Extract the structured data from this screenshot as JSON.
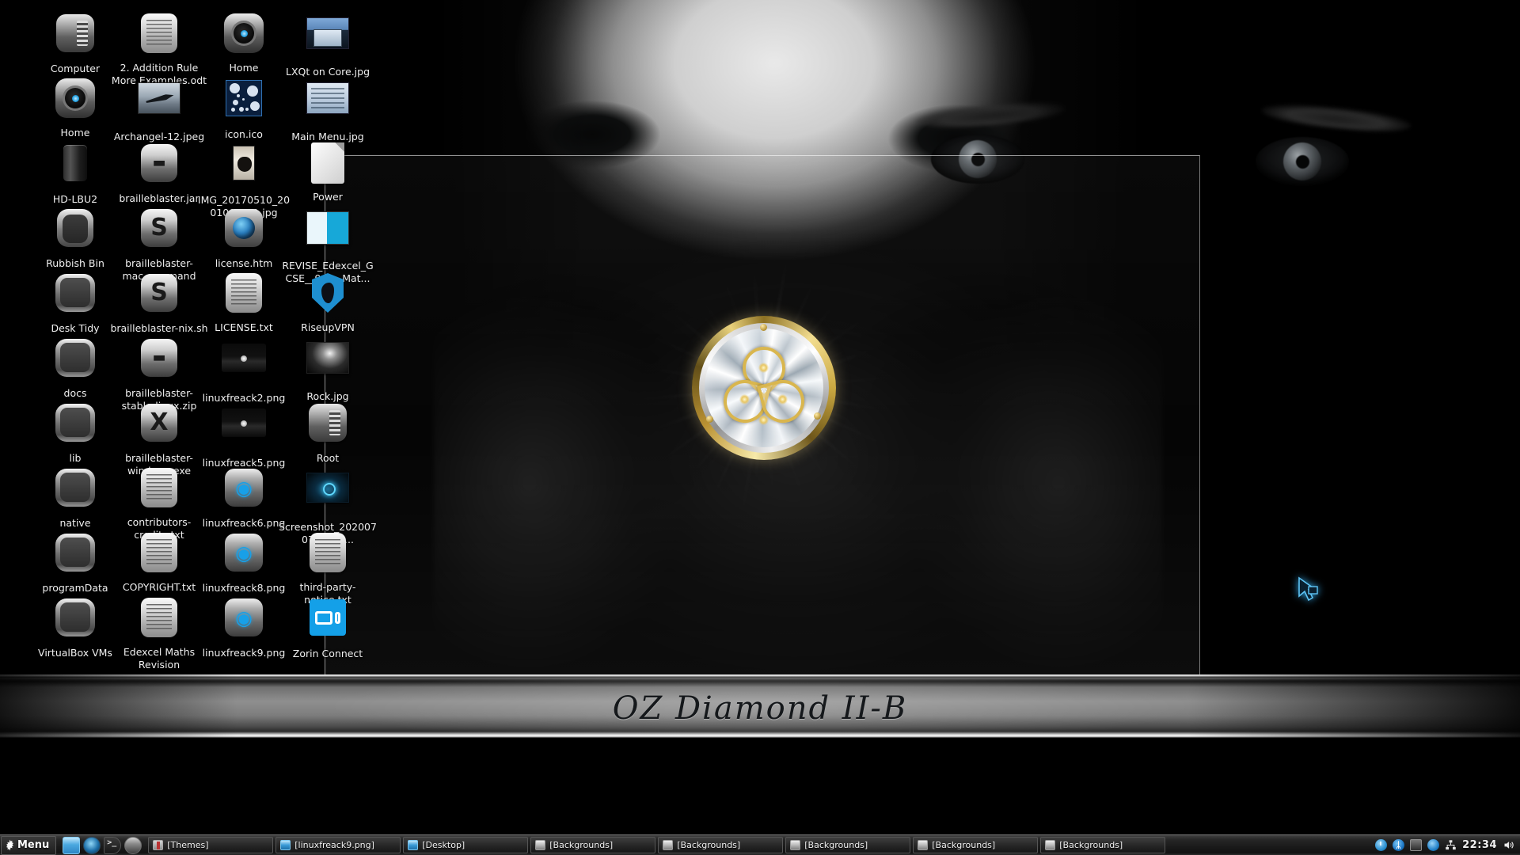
{
  "desktop": {
    "wallpaper_title": "OZ Diamond II-B",
    "emblem_name": "triquetra-diamond-emblem",
    "cursor_name": "blue-glow-pointer"
  },
  "icons": [
    {
      "label": "Computer",
      "art": "comp",
      "col": 0,
      "row": 0
    },
    {
      "label": "2. Addition Rule More Examples.odt",
      "art": "doc",
      "col": 1,
      "row": 0
    },
    {
      "label": "Home",
      "art": "home",
      "col": 2,
      "row": 0
    },
    {
      "label": "LXQt on Core.jpg",
      "art": "lxqt",
      "col": 3,
      "row": 0
    },
    {
      "label": "Home",
      "art": "home",
      "col": 0,
      "row": 1
    },
    {
      "label": "Archangel-12.jpeg",
      "art": "jet",
      "col": 1,
      "row": 1
    },
    {
      "label": "icon.ico",
      "art": "ico",
      "col": 2,
      "row": 1
    },
    {
      "label": "Main Menu.jpg",
      "art": "menu",
      "col": 3,
      "row": 1
    },
    {
      "label": "HD-LBU2",
      "art": "hd",
      "col": 0,
      "row": 2
    },
    {
      "label": "brailleblaster.jar",
      "art": "bbjar",
      "col": 1,
      "row": 2
    },
    {
      "label": "IMG_20170510_200100_001.jpg",
      "art": "cat",
      "col": 2,
      "row": 2
    },
    {
      "label": "Power",
      "art": "plain",
      "col": 3,
      "row": 2
    },
    {
      "label": "Rubbish Bin",
      "art": "bin",
      "col": 0,
      "row": 3
    },
    {
      "label": "brailleblaster-mac.command",
      "art": "bbS",
      "col": 1,
      "row": 3
    },
    {
      "label": "license.htm",
      "art": "globe",
      "col": 2,
      "row": 3
    },
    {
      "label": "REVISE_Edexcel_GCSE__9_1__Mat...",
      "art": "book",
      "col": 3,
      "row": 3
    },
    {
      "label": "Desk Tidy",
      "art": "folder",
      "col": 0,
      "row": 4
    },
    {
      "label": "brailleblaster-nix.sh",
      "art": "bbS",
      "col": 1,
      "row": 4
    },
    {
      "label": "LICENSE.txt",
      "art": "doc",
      "col": 2,
      "row": 4
    },
    {
      "label": "RiseupVPN",
      "art": "shield",
      "col": 3,
      "row": 4
    },
    {
      "label": "docs",
      "art": "folder",
      "col": 0,
      "row": 5
    },
    {
      "label": "brailleblaster-stable-linux.zip",
      "art": "bbjar",
      "col": 1,
      "row": 5
    },
    {
      "label": "linuxfreack2.png",
      "art": "lf",
      "col": 2,
      "row": 5
    },
    {
      "label": "Rock.jpg",
      "art": "rock",
      "col": 3,
      "row": 5
    },
    {
      "label": "lib",
      "art": "folder",
      "col": 0,
      "row": 6
    },
    {
      "label": "brailleblaster-windows.exe",
      "art": "bbX",
      "col": 1,
      "row": 6
    },
    {
      "label": "linuxfreack5.png",
      "art": "lf",
      "col": 2,
      "row": 6
    },
    {
      "label": "Root",
      "art": "comp",
      "col": 3,
      "row": 6
    },
    {
      "label": "native",
      "art": "folder",
      "col": 0,
      "row": 7
    },
    {
      "label": "contributors-credits.txt",
      "art": "doc",
      "col": 1,
      "row": 7
    },
    {
      "label": "linuxfreack6.png",
      "art": "lfb",
      "col": 2,
      "row": 7
    },
    {
      "label": "Screenshot_20200707_2309...",
      "art": "shot",
      "col": 3,
      "row": 7
    },
    {
      "label": "programData",
      "art": "folder",
      "col": 0,
      "row": 8
    },
    {
      "label": "COPYRIGHT.txt",
      "art": "doc",
      "col": 1,
      "row": 8
    },
    {
      "label": "linuxfreack8.png",
      "art": "lfb",
      "col": 2,
      "row": 8
    },
    {
      "label": "third-party-notice.txt",
      "art": "doc",
      "col": 3,
      "row": 8
    },
    {
      "label": "VirtualBox VMs",
      "art": "folder",
      "col": 0,
      "row": 9
    },
    {
      "label": "Edexcel Maths Revision",
      "art": "doc",
      "col": 1,
      "row": 9
    },
    {
      "label": "linuxfreack9.png",
      "art": "lfb",
      "col": 2,
      "row": 9
    },
    {
      "label": "Zorin Connect",
      "art": "zorin",
      "col": 3,
      "row": 9
    }
  ],
  "taskbar": {
    "menu_label": "Menu",
    "menu_icon": "gear-icon",
    "launchers": [
      {
        "name": "file-manager-launcher",
        "art": "lz"
      },
      {
        "name": "browser-launcher",
        "art": "lf"
      },
      {
        "name": "terminal-launcher",
        "art": "lt"
      },
      {
        "name": "app-launcher",
        "art": "lb"
      }
    ],
    "tasks": [
      {
        "label": "[Themes]",
        "icon": "theme"
      },
      {
        "label": "[linuxfreack9.png]",
        "icon": "blue"
      },
      {
        "label": "[Desktop]",
        "icon": "blue"
      },
      {
        "label": "[Backgrounds]",
        "icon": "doc"
      },
      {
        "label": "[Backgrounds]",
        "icon": "doc"
      },
      {
        "label": "[Backgrounds]",
        "icon": "doc"
      },
      {
        "label": "[Backgrounds]",
        "icon": "doc"
      },
      {
        "label": "[Backgrounds]",
        "icon": "doc"
      }
    ],
    "tray": [
      {
        "name": "clock-tray-icon",
        "art": "t-clock"
      },
      {
        "name": "bluetooth-tray-icon",
        "art": "t-bt",
        "glyph": "ᛦ"
      },
      {
        "name": "display-tray-icon",
        "art": "t-disp"
      },
      {
        "name": "update-tray-icon",
        "art": "t-circ"
      },
      {
        "name": "network-tray-icon",
        "art": "t-net"
      }
    ],
    "clock": "22:34",
    "volume_icon": "volume-icon"
  },
  "colors": {
    "accent_blue": "#2f9ddb",
    "gold": "#d8b44a",
    "taskbar_bg": "#1b1b1b",
    "icon_text": "#efefef"
  }
}
